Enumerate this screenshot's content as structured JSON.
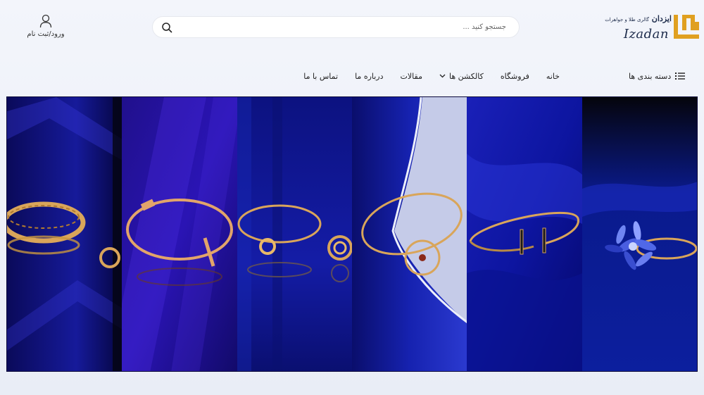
{
  "brand": {
    "name_fa": "ایزدان",
    "subtitle_fa": "گالری طلا و جواهرات",
    "name_en": "Izadan"
  },
  "search": {
    "placeholder": "جستجو کنید ..."
  },
  "account": {
    "label": "ورود/ثبت نام"
  },
  "nav": {
    "categories_label": "دسته بندی ها",
    "items": [
      {
        "label": "خانه"
      },
      {
        "label": "فروشگاه"
      },
      {
        "label": "کالکشن ها"
      },
      {
        "label": "مقالات"
      },
      {
        "label": "درباره ما"
      },
      {
        "label": "تماس با ما"
      }
    ]
  },
  "banner": {
    "panels": [
      {
        "product": "sapphire-flower-ring"
      },
      {
        "product": "gold-bar-cuff-bracelet"
      },
      {
        "product": "circle-cuff-bracelet"
      },
      {
        "product": "knot-bracelet-and-ring"
      },
      {
        "product": "nail-bracelet"
      },
      {
        "product": "patterned-bangle-and-ring"
      }
    ]
  },
  "colors": {
    "background": "#eef1f8",
    "banner_blue": "#1a16a8",
    "gold": "#d9a55a",
    "logo_gold": "#e0a020",
    "text": "#222222"
  },
  "icons": {
    "account": "user-icon",
    "search": "search-icon",
    "categories": "list-icon",
    "dropdown": "chevron-down-icon"
  }
}
